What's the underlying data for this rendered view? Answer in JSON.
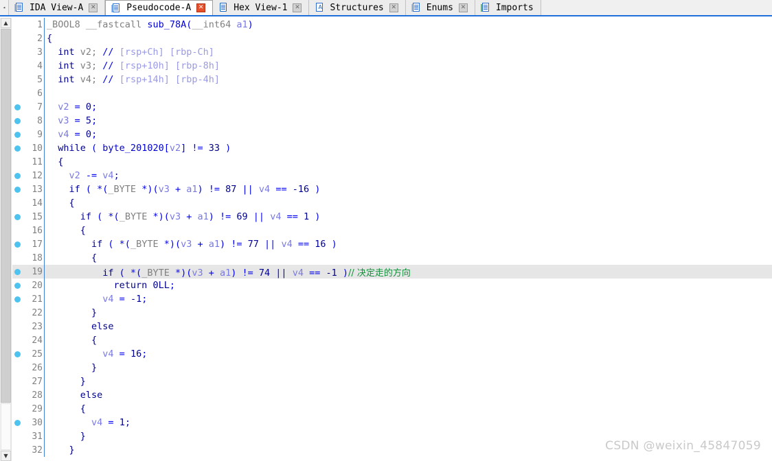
{
  "window": {
    "app": "IDA Pro",
    "active_view": "Pseudocode-A"
  },
  "tabbar": {
    "scroll_left_glyph": "◂",
    "tabs": [
      {
        "label": "IDA View-A",
        "icon": "ida-view-icon",
        "close_label": "✕",
        "active": false
      },
      {
        "label": "Pseudocode-A",
        "icon": "pseudocode-icon",
        "close_label": "✕",
        "active": true
      },
      {
        "label": "Hex View-1",
        "icon": "hex-view-icon",
        "close_label": "✕",
        "active": false
      },
      {
        "label": "Structures",
        "icon": "structures-icon",
        "close_label": "✕",
        "active": false
      },
      {
        "label": "Enums",
        "icon": "enums-icon",
        "close_label": "✕",
        "active": false
      },
      {
        "label": "Imports",
        "icon": "imports-icon",
        "close_label": "",
        "active": false
      }
    ]
  },
  "scrollbar": {
    "up_glyph": "▲",
    "down_glyph": "▼"
  },
  "colors": {
    "breakpoint_dot": "#4ec3f0",
    "active_tab_close": "#e8502b",
    "highlight_line_bg": "#e6e6e6",
    "keyword": "#00008b",
    "variable": "#7a7ae0",
    "punctuation": "#0000ee",
    "user_comment": "#138f3b",
    "auto_comment": "#9a9ae6",
    "line_number": "#808080",
    "tabbar_underline": "#1e6fd9"
  },
  "code": {
    "language": "c-pseudocode",
    "function_name": "sub_78A",
    "lines": [
      {
        "n": 1,
        "bp": false,
        "hl": false,
        "tokens": [
          {
            "t": "_BOOL8 __fastcall ",
            "c": "type"
          },
          {
            "t": "sub_78A",
            "c": "name"
          },
          {
            "t": "(",
            "c": "punct"
          },
          {
            "t": "__int64 ",
            "c": "type"
          },
          {
            "t": "a1",
            "c": "var"
          },
          {
            "t": ")",
            "c": "punct"
          }
        ]
      },
      {
        "n": 2,
        "bp": false,
        "hl": false,
        "tokens": [
          {
            "t": "{",
            "c": "brace"
          }
        ]
      },
      {
        "n": 3,
        "bp": false,
        "hl": false,
        "tokens": [
          {
            "t": "  ",
            "c": "plain"
          },
          {
            "t": "int",
            "c": "kw"
          },
          {
            "t": " v2; ",
            "c": "type"
          },
          {
            "t": "//",
            "c": "cmtslash"
          },
          {
            "t": " [rsp+Ch] [rbp-Ch]",
            "c": "cmtbody"
          }
        ]
      },
      {
        "n": 4,
        "bp": false,
        "hl": false,
        "tokens": [
          {
            "t": "  ",
            "c": "plain"
          },
          {
            "t": "int",
            "c": "kw"
          },
          {
            "t": " v3; ",
            "c": "type"
          },
          {
            "t": "//",
            "c": "cmtslash"
          },
          {
            "t": " [rsp+10h] [rbp-8h]",
            "c": "cmtbody"
          }
        ]
      },
      {
        "n": 5,
        "bp": false,
        "hl": false,
        "tokens": [
          {
            "t": "  ",
            "c": "plain"
          },
          {
            "t": "int",
            "c": "kw"
          },
          {
            "t": " v4; ",
            "c": "type"
          },
          {
            "t": "//",
            "c": "cmtslash"
          },
          {
            "t": " [rsp+14h] [rbp-4h]",
            "c": "cmtbody"
          }
        ]
      },
      {
        "n": 6,
        "bp": false,
        "hl": false,
        "tokens": []
      },
      {
        "n": 7,
        "bp": true,
        "hl": false,
        "tokens": [
          {
            "t": "  ",
            "c": "plain"
          },
          {
            "t": "v2",
            "c": "var"
          },
          {
            "t": " = ",
            "c": "punct"
          },
          {
            "t": "0",
            "c": "num"
          },
          {
            "t": ";",
            "c": "punct"
          }
        ]
      },
      {
        "n": 8,
        "bp": true,
        "hl": false,
        "tokens": [
          {
            "t": "  ",
            "c": "plain"
          },
          {
            "t": "v3",
            "c": "var"
          },
          {
            "t": " = ",
            "c": "punct"
          },
          {
            "t": "5",
            "c": "num"
          },
          {
            "t": ";",
            "c": "punct"
          }
        ]
      },
      {
        "n": 9,
        "bp": true,
        "hl": false,
        "tokens": [
          {
            "t": "  ",
            "c": "plain"
          },
          {
            "t": "v4",
            "c": "var"
          },
          {
            "t": " = ",
            "c": "punct"
          },
          {
            "t": "0",
            "c": "num"
          },
          {
            "t": ";",
            "c": "punct"
          }
        ]
      },
      {
        "n": 10,
        "bp": true,
        "hl": false,
        "tokens": [
          {
            "t": "  ",
            "c": "plain"
          },
          {
            "t": "while",
            "c": "kw"
          },
          {
            "t": " ( ",
            "c": "punct"
          },
          {
            "t": "byte_201020",
            "c": "name"
          },
          {
            "t": "[",
            "c": "punct"
          },
          {
            "t": "v2",
            "c": "var"
          },
          {
            "t": "] != ",
            "c": "punct"
          },
          {
            "t": "33",
            "c": "num"
          },
          {
            "t": " )",
            "c": "punct"
          }
        ]
      },
      {
        "n": 11,
        "bp": false,
        "hl": false,
        "tokens": [
          {
            "t": "  {",
            "c": "brace"
          }
        ]
      },
      {
        "n": 12,
        "bp": true,
        "hl": false,
        "tokens": [
          {
            "t": "    ",
            "c": "plain"
          },
          {
            "t": "v2",
            "c": "var"
          },
          {
            "t": " -= ",
            "c": "punct"
          },
          {
            "t": "v4",
            "c": "var"
          },
          {
            "t": ";",
            "c": "punct"
          }
        ]
      },
      {
        "n": 13,
        "bp": true,
        "hl": false,
        "tokens": [
          {
            "t": "    ",
            "c": "plain"
          },
          {
            "t": "if",
            "c": "kw"
          },
          {
            "t": " ( *(",
            "c": "punct"
          },
          {
            "t": "_BYTE",
            "c": "type"
          },
          {
            "t": " *)(",
            "c": "punct"
          },
          {
            "t": "v3",
            "c": "var"
          },
          {
            "t": " + ",
            "c": "punct"
          },
          {
            "t": "a1",
            "c": "var"
          },
          {
            "t": ") != ",
            "c": "punct"
          },
          {
            "t": "87",
            "c": "num"
          },
          {
            "t": " || ",
            "c": "punct"
          },
          {
            "t": "v4",
            "c": "var"
          },
          {
            "t": " == ",
            "c": "punct"
          },
          {
            "t": "-16",
            "c": "num"
          },
          {
            "t": " )",
            "c": "punct"
          }
        ]
      },
      {
        "n": 14,
        "bp": false,
        "hl": false,
        "tokens": [
          {
            "t": "    {",
            "c": "brace"
          }
        ]
      },
      {
        "n": 15,
        "bp": true,
        "hl": false,
        "tokens": [
          {
            "t": "      ",
            "c": "plain"
          },
          {
            "t": "if",
            "c": "kw"
          },
          {
            "t": " ( *(",
            "c": "punct"
          },
          {
            "t": "_BYTE",
            "c": "type"
          },
          {
            "t": " *)(",
            "c": "punct"
          },
          {
            "t": "v3",
            "c": "var"
          },
          {
            "t": " + ",
            "c": "punct"
          },
          {
            "t": "a1",
            "c": "var"
          },
          {
            "t": ") != ",
            "c": "punct"
          },
          {
            "t": "69",
            "c": "num"
          },
          {
            "t": " || ",
            "c": "punct"
          },
          {
            "t": "v4",
            "c": "var"
          },
          {
            "t": " == ",
            "c": "punct"
          },
          {
            "t": "1",
            "c": "num"
          },
          {
            "t": " )",
            "c": "punct"
          }
        ]
      },
      {
        "n": 16,
        "bp": false,
        "hl": false,
        "tokens": [
          {
            "t": "      {",
            "c": "brace"
          }
        ]
      },
      {
        "n": 17,
        "bp": true,
        "hl": false,
        "tokens": [
          {
            "t": "        ",
            "c": "plain"
          },
          {
            "t": "if",
            "c": "kw"
          },
          {
            "t": " ( *(",
            "c": "punct"
          },
          {
            "t": "_BYTE",
            "c": "type"
          },
          {
            "t": " *)(",
            "c": "punct"
          },
          {
            "t": "v3",
            "c": "var"
          },
          {
            "t": " + ",
            "c": "punct"
          },
          {
            "t": "a1",
            "c": "var"
          },
          {
            "t": ") != ",
            "c": "punct"
          },
          {
            "t": "77",
            "c": "num"
          },
          {
            "t": " || ",
            "c": "punct"
          },
          {
            "t": "v4",
            "c": "var"
          },
          {
            "t": " == ",
            "c": "punct"
          },
          {
            "t": "16",
            "c": "num"
          },
          {
            "t": " )",
            "c": "punct"
          }
        ]
      },
      {
        "n": 18,
        "bp": false,
        "hl": false,
        "tokens": [
          {
            "t": "        {",
            "c": "brace"
          }
        ]
      },
      {
        "n": 19,
        "bp": true,
        "hl": true,
        "tokens": [
          {
            "t": "          ",
            "c": "plain"
          },
          {
            "t": "if",
            "c": "kw"
          },
          {
            "t": " ( *(",
            "c": "punct"
          },
          {
            "t": "_BYTE",
            "c": "type"
          },
          {
            "t": " *)(",
            "c": "punct"
          },
          {
            "t": "v3",
            "c": "var"
          },
          {
            "t": " + ",
            "c": "punct"
          },
          {
            "t": "a1",
            "c": "var"
          },
          {
            "t": ") != ",
            "c": "punct"
          },
          {
            "t": "74",
            "c": "num"
          },
          {
            "t": " || ",
            "c": "punct"
          },
          {
            "t": "v4",
            "c": "var"
          },
          {
            "t": " == ",
            "c": "punct"
          },
          {
            "t": "-1",
            "c": "num"
          },
          {
            "t": " )",
            "c": "punct"
          },
          {
            "t": "// 决定走的方向",
            "c": "usercmt"
          }
        ]
      },
      {
        "n": 20,
        "bp": true,
        "hl": false,
        "tokens": [
          {
            "t": "            ",
            "c": "plain"
          },
          {
            "t": "return",
            "c": "kw"
          },
          {
            "t": " ",
            "c": "plain"
          },
          {
            "t": "0LL",
            "c": "num"
          },
          {
            "t": ";",
            "c": "punct"
          }
        ]
      },
      {
        "n": 21,
        "bp": true,
        "hl": false,
        "tokens": [
          {
            "t": "          ",
            "c": "plain"
          },
          {
            "t": "v4",
            "c": "var"
          },
          {
            "t": " = ",
            "c": "punct"
          },
          {
            "t": "-1",
            "c": "num"
          },
          {
            "t": ";",
            "c": "punct"
          }
        ]
      },
      {
        "n": 22,
        "bp": false,
        "hl": false,
        "tokens": [
          {
            "t": "        }",
            "c": "brace"
          }
        ]
      },
      {
        "n": 23,
        "bp": false,
        "hl": false,
        "tokens": [
          {
            "t": "        ",
            "c": "plain"
          },
          {
            "t": "else",
            "c": "kw"
          }
        ]
      },
      {
        "n": 24,
        "bp": false,
        "hl": false,
        "tokens": [
          {
            "t": "        {",
            "c": "brace"
          }
        ]
      },
      {
        "n": 25,
        "bp": true,
        "hl": false,
        "tokens": [
          {
            "t": "          ",
            "c": "plain"
          },
          {
            "t": "v4",
            "c": "var"
          },
          {
            "t": " = ",
            "c": "punct"
          },
          {
            "t": "16",
            "c": "num"
          },
          {
            "t": ";",
            "c": "punct"
          }
        ]
      },
      {
        "n": 26,
        "bp": false,
        "hl": false,
        "tokens": [
          {
            "t": "        }",
            "c": "brace"
          }
        ]
      },
      {
        "n": 27,
        "bp": false,
        "hl": false,
        "tokens": [
          {
            "t": "      }",
            "c": "brace"
          }
        ]
      },
      {
        "n": 28,
        "bp": false,
        "hl": false,
        "tokens": [
          {
            "t": "      ",
            "c": "plain"
          },
          {
            "t": "else",
            "c": "kw"
          }
        ]
      },
      {
        "n": 29,
        "bp": false,
        "hl": false,
        "tokens": [
          {
            "t": "      {",
            "c": "brace"
          }
        ]
      },
      {
        "n": 30,
        "bp": true,
        "hl": false,
        "tokens": [
          {
            "t": "        ",
            "c": "plain"
          },
          {
            "t": "v4",
            "c": "var"
          },
          {
            "t": " = ",
            "c": "punct"
          },
          {
            "t": "1",
            "c": "num"
          },
          {
            "t": ";",
            "c": "punct"
          }
        ]
      },
      {
        "n": 31,
        "bp": false,
        "hl": false,
        "tokens": [
          {
            "t": "      }",
            "c": "brace"
          }
        ]
      },
      {
        "n": 32,
        "bp": false,
        "hl": false,
        "tokens": [
          {
            "t": "    }",
            "c": "brace"
          }
        ]
      }
    ]
  },
  "watermark": {
    "text": "CSDN @weixin_45847059"
  }
}
